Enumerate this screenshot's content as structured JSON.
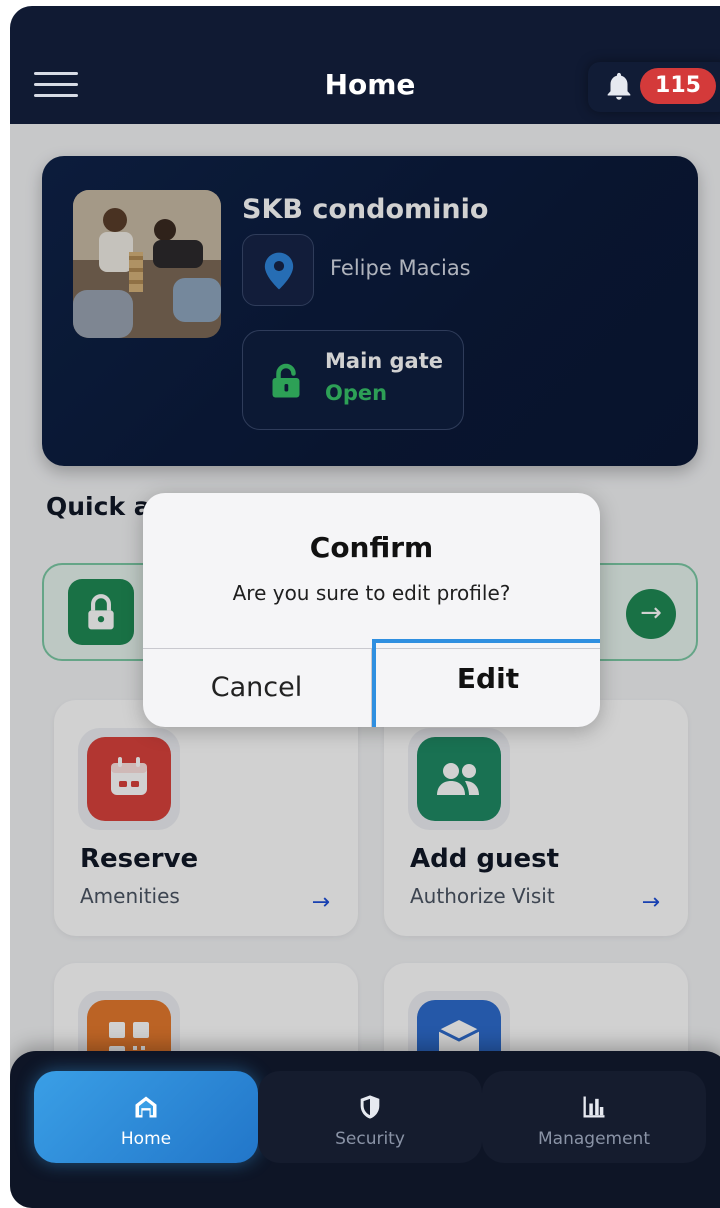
{
  "header": {
    "title": "Home",
    "notification_count": "115"
  },
  "condo": {
    "name": "SKB condominio",
    "owner": "Felipe Macias",
    "gate": {
      "title": "Main gate",
      "status": "Open"
    }
  },
  "quick_access": {
    "title": "Quick a"
  },
  "cards": [
    {
      "title": "Reserve",
      "subtitle": "Amenities",
      "icon": "calendar-icon",
      "color": "#d9423c"
    },
    {
      "title": "Add guest",
      "subtitle": "Authorize Visit",
      "icon": "users-icon",
      "color": "#1f8a64"
    },
    {
      "title": "",
      "subtitle": "",
      "icon": "qr-code-icon",
      "color": "#e4792e"
    },
    {
      "title": "",
      "subtitle": "",
      "icon": "package-icon",
      "color": "#2e6ccd"
    }
  ],
  "dialog": {
    "title": "Confirm",
    "message": "Are you sure to edit profile?",
    "cancel_label": "Cancel",
    "confirm_label": "Edit"
  },
  "nav": {
    "items": [
      {
        "label": "Home",
        "icon": "home-icon",
        "active": true
      },
      {
        "label": "Security",
        "icon": "shield-icon",
        "active": false
      },
      {
        "label": "Management",
        "icon": "bar-chart-icon",
        "active": false
      }
    ]
  },
  "colors": {
    "header_bg": "#101a33",
    "badge": "#d43a3a",
    "accent_green": "#37c46a",
    "active_nav": "#3a9fe6"
  }
}
